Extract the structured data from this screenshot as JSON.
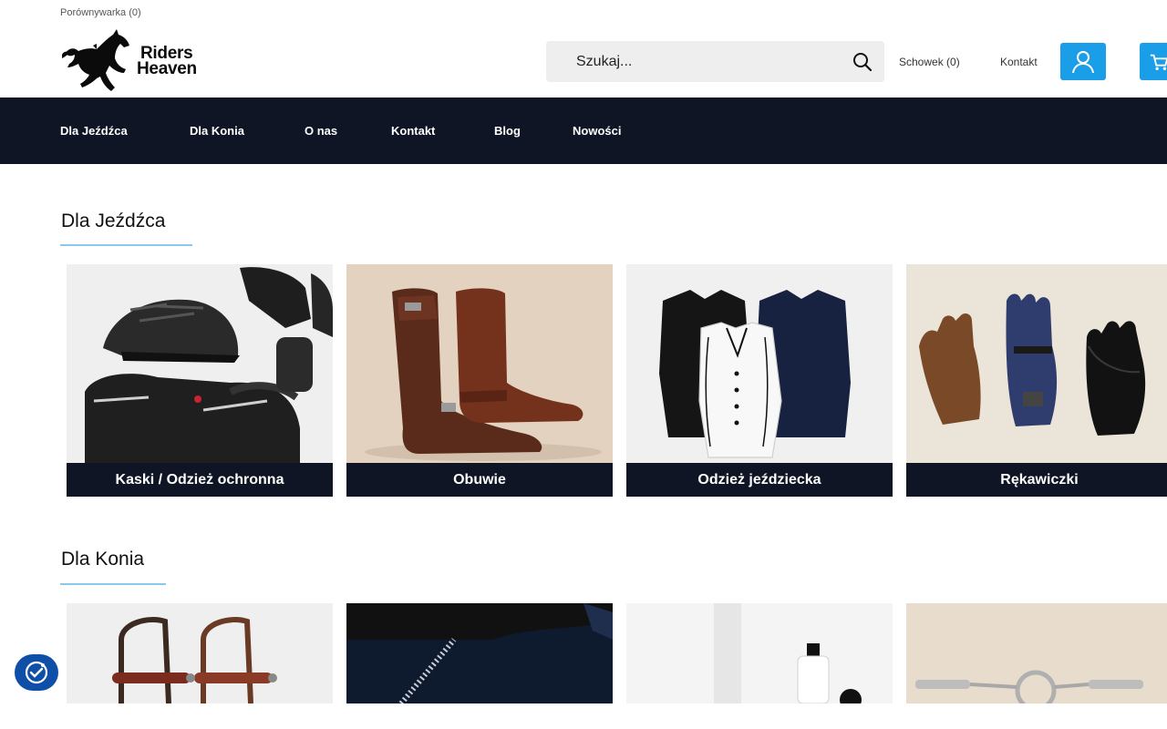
{
  "header": {
    "compare_label": "Porównywarka (0)",
    "logo_line1": "Riders",
    "logo_line2": "Heaven",
    "search_placeholder": "Szukaj...",
    "wishlist_label": "Schowek (0)",
    "contact_label": "Kontakt"
  },
  "nav": {
    "items": [
      "Dla Jeźdźca",
      "Dla Konia",
      "O nas",
      "Kontakt",
      "Blog",
      "Nowości"
    ]
  },
  "sections": [
    {
      "title": "Dla Jeźdźca",
      "cards": [
        "Kaski / Odzież ochronna",
        "Obuwie",
        "Odzież jeździecka",
        "Rękawiczki"
      ]
    },
    {
      "title": "Dla Konia",
      "cards": []
    }
  ],
  "colors": {
    "accent": "#1a9ee8",
    "nav_bg": "#0f1524",
    "underline": "#8cc7ee"
  }
}
